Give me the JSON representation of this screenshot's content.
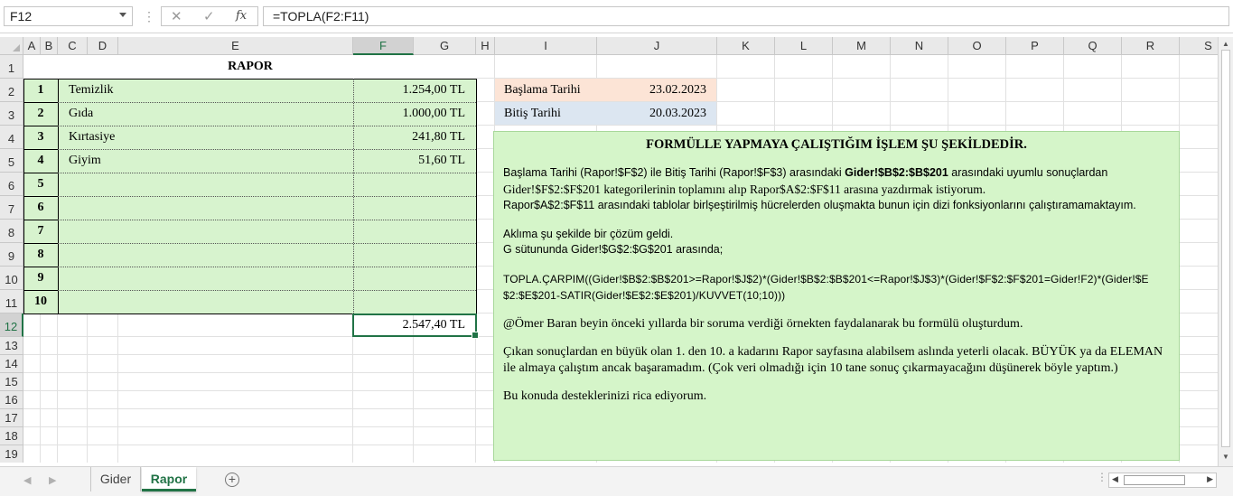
{
  "formula_bar": {
    "name_box": "F12",
    "cancel_glyph": "✕",
    "enter_glyph": "✓",
    "fx_label": "fx",
    "formula": "=TOPLA(F2:F11)"
  },
  "columns": [
    "A",
    "B",
    "C",
    "D",
    "E",
    "F",
    "G",
    "H",
    "I",
    "J",
    "K",
    "L",
    "M",
    "N",
    "O",
    "P",
    "Q",
    "R",
    "S"
  ],
  "rows": [
    "1",
    "2",
    "3",
    "4",
    "5",
    "6",
    "7",
    "8",
    "9",
    "10",
    "11",
    "12",
    "13",
    "14",
    "15",
    "16",
    "17",
    "18",
    "19"
  ],
  "selected_cell": {
    "column": "F",
    "row": "12"
  },
  "rapor": {
    "title": "RAPOR",
    "items": [
      {
        "no": "1",
        "category": "Temizlik",
        "amount": "1.254,00 TL"
      },
      {
        "no": "2",
        "category": "Gıda",
        "amount": "1.000,00 TL"
      },
      {
        "no": "3",
        "category": "Kırtasiye",
        "amount": "241,80 TL"
      },
      {
        "no": "4",
        "category": "Giyim",
        "amount": "51,60 TL"
      },
      {
        "no": "5",
        "category": "",
        "amount": ""
      },
      {
        "no": "6",
        "category": "",
        "amount": ""
      },
      {
        "no": "7",
        "category": "",
        "amount": ""
      },
      {
        "no": "8",
        "category": "",
        "amount": ""
      },
      {
        "no": "9",
        "category": "",
        "amount": ""
      },
      {
        "no": "10",
        "category": "",
        "amount": ""
      }
    ],
    "total": "2.547,40 TL"
  },
  "dates": {
    "start_label": "Başlama Tarihi",
    "start_value": "23.02.2023",
    "end_label": "Bitiş Tarihi",
    "end_value": "20.03.2023",
    "start_color": "#fce4d6",
    "end_color": "#dce6f1"
  },
  "note": {
    "heading": "FORMÜLLE YAPMAYA ÇALIŞTIĞIM İŞLEM ŞU ŞEKİLDEDİR.",
    "p1_a": "Başlama Tarihi (Rapor!$F$2) ile Bitiş Tarihi (Rapor!$F$3) arasındaki ",
    "p1_bold": "Gider!$B$2:$B$201",
    "p1_b": " arasındaki uyumlu sonuçlardan",
    "p1_c": "Gider!$F$2:$F$201 kategorilerinin toplamını alıp Rapor$A$2:$F$11 arasına yazdırmak istiyorum.",
    "p1_d": "Rapor$A$2:$F$11 arasındaki tablolar birlşeştirilmiş hücrelerden oluşmakta bunun için dizi fonksiyonlarını çalıştıramamaktayım.",
    "p2_a": "Aklıma şu şekilde bir çözüm geldi.",
    "p2_b": "G sütununda Gider!$G$2:$G$201 arasında;",
    "p3_formula": "TOPLA.ÇARPIM((Gider!$B$2:$B$201>=Rapor!$J$2)*(Gider!$B$2:$B$201<=Rapor!$J$3)*(Gider!$F$2:$F$201=Gider!F2)*(Gider!$E$2:$E$201-SATIR(Gider!$E$2:$E$201)/KUVVET(10;10)))",
    "p4": "@Ömer Baran beyin önceki yıllarda bir soruma verdiği örnekten faydalanarak bu formülü oluşturdum.",
    "p5": "Çıkan sonuçlardan en büyük olan 1. den 10. a kadarını Rapor sayfasına alabilsem aslında yeterli olacak. BÜYÜK ya da ELEMAN ile almaya çalıştım ancak başaramadım. (Çok veri olmadığı için 10 tane sonuç çıkarmayacağını düşünerek böyle yaptım.)",
    "p6": "Bu konuda desteklerinizi rica ediyorum."
  },
  "sheets": {
    "tab1": "Gider",
    "tab2": "Rapor",
    "active": "Rapor",
    "add_glyph": "+"
  },
  "colors": {
    "accent": "#217346",
    "table_fill": "#d7f3ce",
    "note_fill": "#d5f5c9"
  },
  "icons": {
    "name_box_dropdown": "chevron-down-icon",
    "cancel": "close-icon",
    "enter": "check-icon",
    "function": "fx-icon",
    "add_sheet": "plus-circle-icon"
  }
}
